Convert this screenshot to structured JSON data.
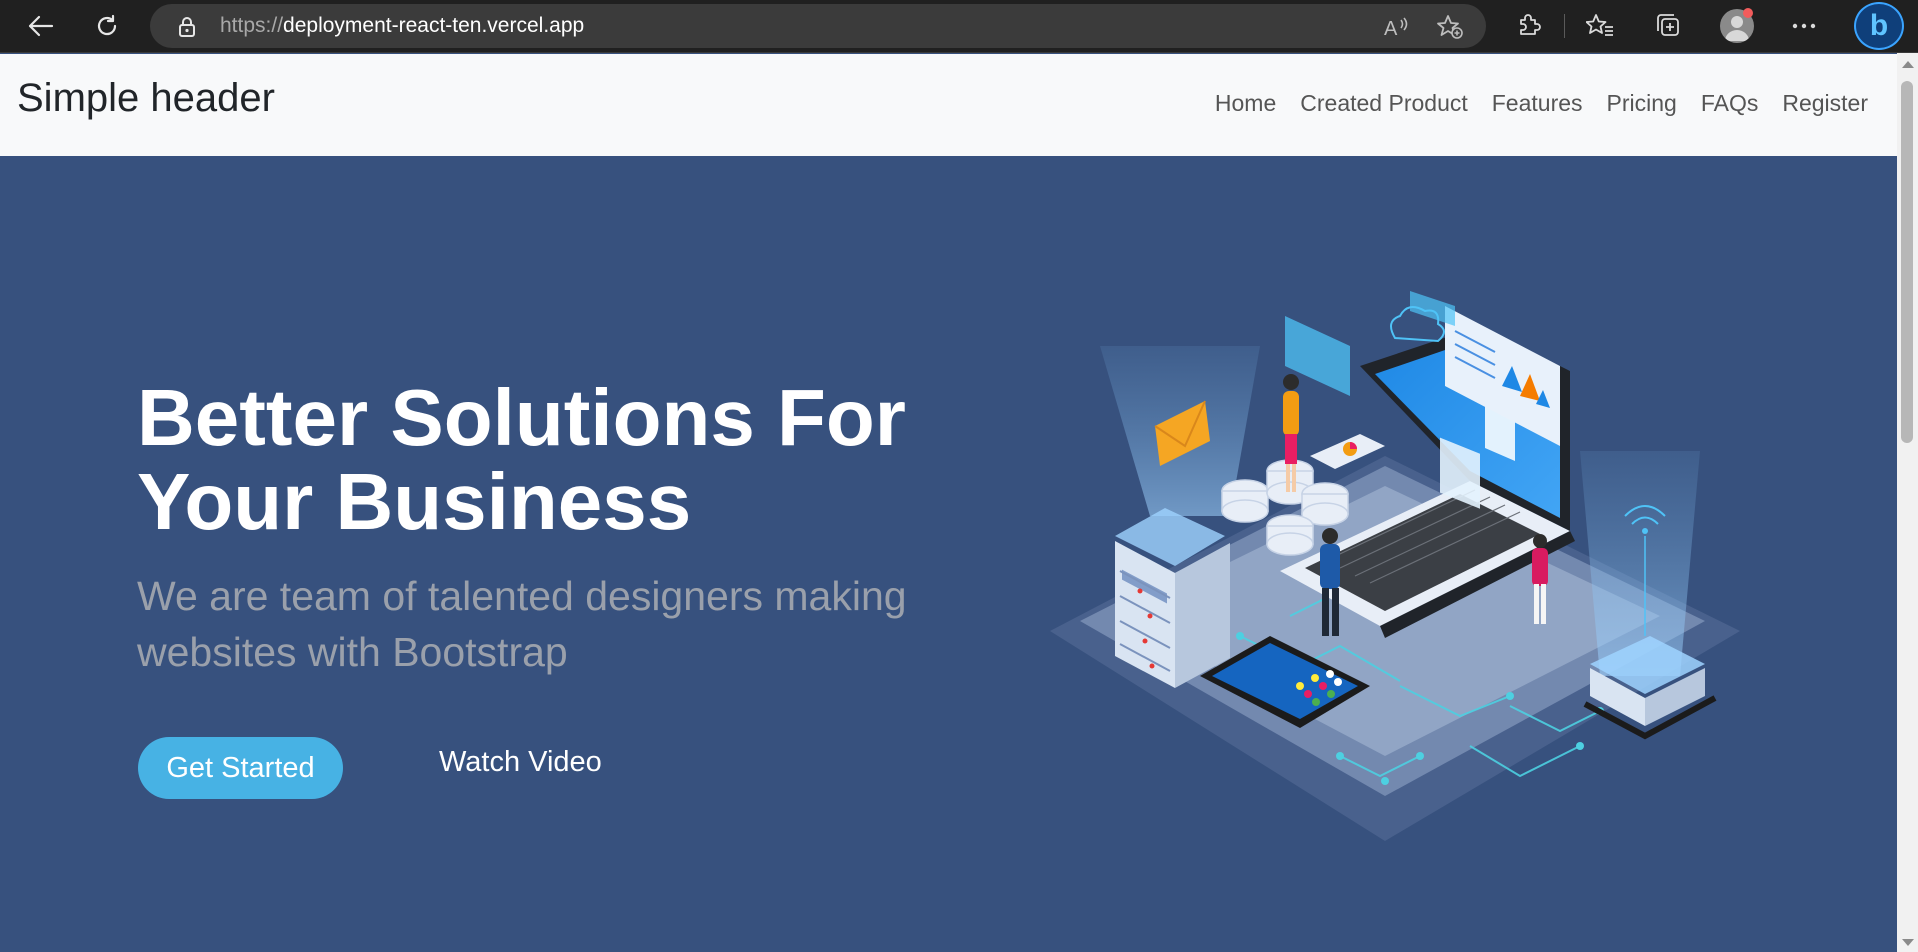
{
  "browser": {
    "url_prefix": "https://",
    "url_domain": "deployment-react-ten.vercel.app",
    "icons": [
      "back-icon",
      "refresh-icon",
      "lock-icon",
      "read-aloud-icon",
      "add-favorite-icon",
      "extensions-icon",
      "favorites-icon",
      "collections-icon",
      "profile-avatar",
      "more-icon",
      "bing-icon"
    ]
  },
  "header": {
    "brand": "Simple header",
    "nav": [
      "Home",
      "Created Product",
      "Features",
      "Pricing",
      "FAQs",
      "Register"
    ]
  },
  "hero": {
    "title_line1": "Better Solutions For",
    "title_line2": "Your Business",
    "subtitle_line1": "We are team of talented designers making",
    "subtitle_line2": "websites with Bootstrap",
    "cta_primary": "Get Started",
    "cta_secondary": "Watch Video"
  },
  "colors": {
    "hero_bg": "#37517e",
    "header_bg": "#f8f9fa",
    "cta_bg": "#47b2e4",
    "browser_bg": "#202020"
  }
}
